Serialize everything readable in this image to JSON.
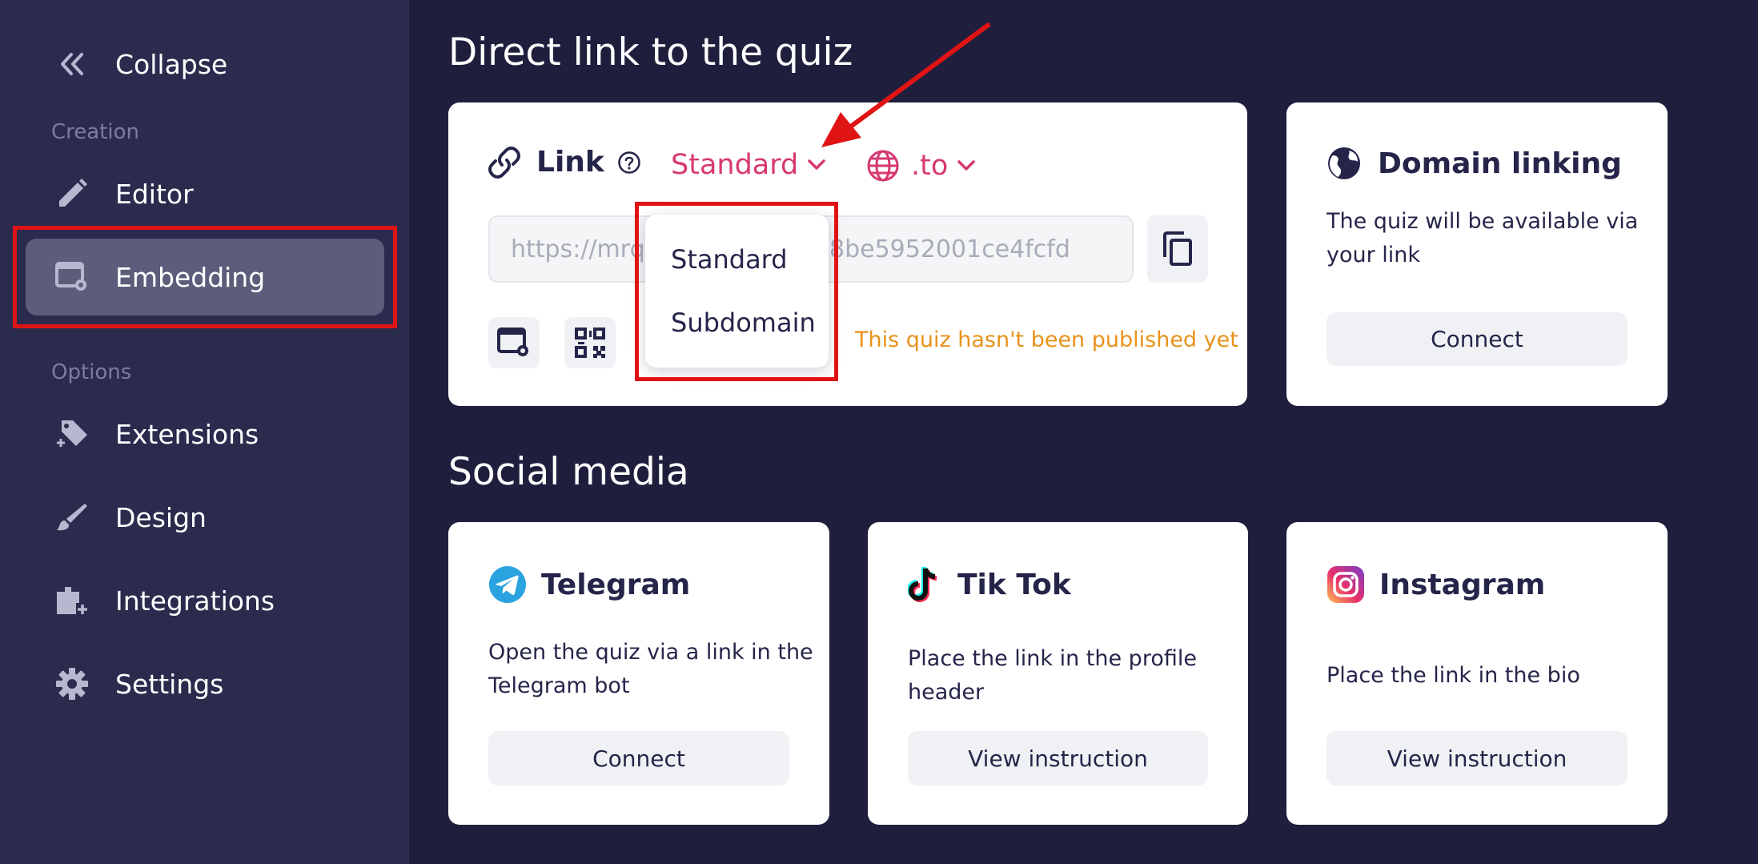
{
  "sidebar": {
    "collapse_label": "Collapse",
    "sections": {
      "creation": "Creation",
      "options": "Options"
    },
    "items": [
      {
        "label": "Editor",
        "icon": "pencil-icon"
      },
      {
        "label": "Embedding",
        "icon": "embed-settings-icon",
        "active": true
      },
      {
        "label": "Extensions",
        "icon": "puzzle-icon"
      },
      {
        "label": "Design",
        "icon": "brush-icon"
      },
      {
        "label": "Integrations",
        "icon": "integrations-icon"
      },
      {
        "label": "Settings",
        "icon": "gear-icon"
      }
    ]
  },
  "direct_link": {
    "heading": "Direct link to the quiz",
    "link_label": "Link",
    "link_type_selected": "Standard",
    "domain_zone": ".to",
    "url_prefix": "https://mrqz",
    "url_suffix": "8be5952001ce4fcfd",
    "status": "This quiz hasn't been published yet",
    "dropdown_options": [
      "Standard",
      "Subdomain"
    ]
  },
  "domain_linking": {
    "title": "Domain linking",
    "text_line1": "The quiz will be available via",
    "text_line2": "your link",
    "button": "Connect"
  },
  "social": {
    "heading": "Social media",
    "telegram": {
      "title": "Telegram",
      "text_line1": "Open the quiz via a link in the",
      "text_line2": "Telegram bot",
      "button": "Connect"
    },
    "tiktok": {
      "title": "Tik Tok",
      "text_line1": "Place the link in the profile",
      "text_line2": "header",
      "button": "View instruction"
    },
    "instagram": {
      "title": "Instagram",
      "text_line1": "Place the link in the bio",
      "button": "View instruction"
    }
  },
  "colors": {
    "accent_pink": "#d63972",
    "status_orange": "#e8921a",
    "annotation_red": "#e01414",
    "background": "#1f1f3d",
    "sidebar": "#2b2b4e"
  }
}
